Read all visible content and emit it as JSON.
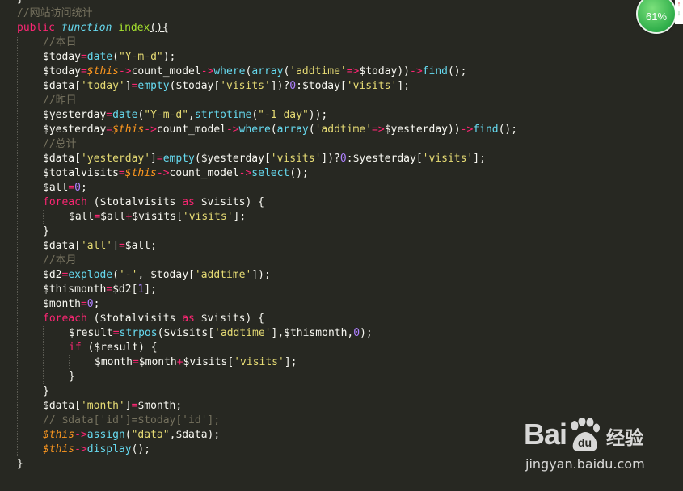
{
  "editor": {
    "lines": [
      {
        "indent": 0,
        "tokens": [
          {
            "t": "}",
            "c": "bracket"
          }
        ]
      },
      {
        "indent": 0,
        "tokens": [
          {
            "t": "//网站访问统计",
            "c": "cm"
          }
        ]
      },
      {
        "indent": 0,
        "tokens": [
          {
            "t": "public",
            "c": "kw"
          },
          {
            "t": " ",
            "c": "var"
          },
          {
            "t": "function",
            "c": "storage"
          },
          {
            "t": " ",
            "c": "var"
          },
          {
            "t": "index",
            "c": "def"
          },
          {
            "t": "(){",
            "c": "brace-hl"
          }
        ]
      },
      {
        "indent": 1,
        "tokens": [
          {
            "t": "//本日",
            "c": "cm"
          }
        ]
      },
      {
        "indent": 1,
        "tokens": [
          {
            "t": "$today",
            "c": "var"
          },
          {
            "t": "=",
            "c": "op"
          },
          {
            "t": "date",
            "c": "fn"
          },
          {
            "t": "(",
            "c": "bracket"
          },
          {
            "t": "\"Y-m-d\"",
            "c": "str"
          },
          {
            "t": ");",
            "c": "bracket"
          }
        ]
      },
      {
        "indent": 1,
        "tokens": [
          {
            "t": "$today",
            "c": "var"
          },
          {
            "t": "=",
            "c": "op"
          },
          {
            "t": "$this",
            "c": "this"
          },
          {
            "t": "->",
            "c": "op"
          },
          {
            "t": "count_model",
            "c": "var"
          },
          {
            "t": "->",
            "c": "op"
          },
          {
            "t": "where",
            "c": "fn"
          },
          {
            "t": "(",
            "c": "bracket"
          },
          {
            "t": "array",
            "c": "fn"
          },
          {
            "t": "(",
            "c": "bracket"
          },
          {
            "t": "'addtime'",
            "c": "str"
          },
          {
            "t": "=>",
            "c": "op"
          },
          {
            "t": "$today",
            "c": "var"
          },
          {
            "t": "))",
            "c": "bracket"
          },
          {
            "t": "->",
            "c": "op"
          },
          {
            "t": "find",
            "c": "fn"
          },
          {
            "t": "();",
            "c": "bracket"
          }
        ]
      },
      {
        "indent": 1,
        "tokens": [
          {
            "t": "$data[",
            "c": "var"
          },
          {
            "t": "'today'",
            "c": "str"
          },
          {
            "t": "]",
            "c": "var"
          },
          {
            "t": "=",
            "c": "op"
          },
          {
            "t": "empty",
            "c": "fn"
          },
          {
            "t": "(",
            "c": "bracket"
          },
          {
            "t": "$today[",
            "c": "var"
          },
          {
            "t": "'visits'",
            "c": "str"
          },
          {
            "t": "])?",
            "c": "var"
          },
          {
            "t": "0",
            "c": "num"
          },
          {
            "t": ":",
            "c": "var"
          },
          {
            "t": "$today[",
            "c": "var"
          },
          {
            "t": "'visits'",
            "c": "str"
          },
          {
            "t": "];",
            "c": "var"
          }
        ]
      },
      {
        "indent": 1,
        "tokens": [
          {
            "t": "//昨日",
            "c": "cm"
          }
        ]
      },
      {
        "indent": 1,
        "tokens": [
          {
            "t": "$yesterday",
            "c": "var"
          },
          {
            "t": "=",
            "c": "op"
          },
          {
            "t": "date",
            "c": "fn"
          },
          {
            "t": "(",
            "c": "bracket"
          },
          {
            "t": "\"Y-m-d\"",
            "c": "str"
          },
          {
            "t": ",",
            "c": "var"
          },
          {
            "t": "strtotime",
            "c": "fn"
          },
          {
            "t": "(",
            "c": "bracket"
          },
          {
            "t": "\"-1 day\"",
            "c": "str"
          },
          {
            "t": "));",
            "c": "bracket"
          }
        ]
      },
      {
        "indent": 1,
        "tokens": [
          {
            "t": "$yesterday",
            "c": "var"
          },
          {
            "t": "=",
            "c": "op"
          },
          {
            "t": "$this",
            "c": "this"
          },
          {
            "t": "->",
            "c": "op"
          },
          {
            "t": "count_model",
            "c": "var"
          },
          {
            "t": "->",
            "c": "op"
          },
          {
            "t": "where",
            "c": "fn"
          },
          {
            "t": "(",
            "c": "bracket"
          },
          {
            "t": "array",
            "c": "fn"
          },
          {
            "t": "(",
            "c": "bracket"
          },
          {
            "t": "'addtime'",
            "c": "str"
          },
          {
            "t": "=>",
            "c": "op"
          },
          {
            "t": "$yesterday",
            "c": "var"
          },
          {
            "t": "))",
            "c": "bracket"
          },
          {
            "t": "->",
            "c": "op"
          },
          {
            "t": "find",
            "c": "fn"
          },
          {
            "t": "();",
            "c": "bracket"
          }
        ]
      },
      {
        "indent": 1,
        "tokens": [
          {
            "t": "//总计",
            "c": "cm"
          }
        ]
      },
      {
        "indent": 1,
        "tokens": [
          {
            "t": "$data[",
            "c": "var"
          },
          {
            "t": "'yesterday'",
            "c": "str"
          },
          {
            "t": "]",
            "c": "var"
          },
          {
            "t": "=",
            "c": "op"
          },
          {
            "t": "empty",
            "c": "fn"
          },
          {
            "t": "(",
            "c": "bracket"
          },
          {
            "t": "$yesterday[",
            "c": "var"
          },
          {
            "t": "'visits'",
            "c": "str"
          },
          {
            "t": "])?",
            "c": "var"
          },
          {
            "t": "0",
            "c": "num"
          },
          {
            "t": ":",
            "c": "var"
          },
          {
            "t": "$yesterday[",
            "c": "var"
          },
          {
            "t": "'visits'",
            "c": "str"
          },
          {
            "t": "];",
            "c": "var"
          }
        ]
      },
      {
        "indent": 1,
        "tokens": [
          {
            "t": "$totalvisits",
            "c": "var"
          },
          {
            "t": "=",
            "c": "op"
          },
          {
            "t": "$this",
            "c": "this"
          },
          {
            "t": "->",
            "c": "op"
          },
          {
            "t": "count_model",
            "c": "var"
          },
          {
            "t": "->",
            "c": "op"
          },
          {
            "t": "select",
            "c": "fn"
          },
          {
            "t": "();",
            "c": "bracket"
          }
        ]
      },
      {
        "indent": 1,
        "tokens": [
          {
            "t": "$all",
            "c": "var"
          },
          {
            "t": "=",
            "c": "op"
          },
          {
            "t": "0",
            "c": "num"
          },
          {
            "t": ";",
            "c": "var"
          }
        ]
      },
      {
        "indent": 1,
        "tokens": [
          {
            "t": "foreach",
            "c": "kw"
          },
          {
            "t": " ($totalvisits ",
            "c": "var"
          },
          {
            "t": "as",
            "c": "kw"
          },
          {
            "t": " $visits) {",
            "c": "var"
          }
        ]
      },
      {
        "indent": 2,
        "tokens": [
          {
            "t": "$all",
            "c": "var"
          },
          {
            "t": "=",
            "c": "op"
          },
          {
            "t": "$all",
            "c": "var"
          },
          {
            "t": "+",
            "c": "op"
          },
          {
            "t": "$visits[",
            "c": "var"
          },
          {
            "t": "'visits'",
            "c": "str"
          },
          {
            "t": "];",
            "c": "var"
          }
        ]
      },
      {
        "indent": 1,
        "tokens": [
          {
            "t": "}",
            "c": "bracket"
          }
        ]
      },
      {
        "indent": 1,
        "tokens": [
          {
            "t": "$data[",
            "c": "var"
          },
          {
            "t": "'all'",
            "c": "str"
          },
          {
            "t": "]",
            "c": "var"
          },
          {
            "t": "=",
            "c": "op"
          },
          {
            "t": "$all;",
            "c": "var"
          }
        ]
      },
      {
        "indent": 1,
        "tokens": [
          {
            "t": "//本月",
            "c": "cm"
          }
        ]
      },
      {
        "indent": 1,
        "tokens": [
          {
            "t": "$d2",
            "c": "var"
          },
          {
            "t": "=",
            "c": "op"
          },
          {
            "t": "explode",
            "c": "fn"
          },
          {
            "t": "(",
            "c": "bracket"
          },
          {
            "t": "'-'",
            "c": "str"
          },
          {
            "t": ", $today[",
            "c": "var"
          },
          {
            "t": "'addtime'",
            "c": "str"
          },
          {
            "t": "]);",
            "c": "var"
          }
        ]
      },
      {
        "indent": 1,
        "tokens": [
          {
            "t": "$thismonth",
            "c": "var"
          },
          {
            "t": "=",
            "c": "op"
          },
          {
            "t": "$d2[",
            "c": "var"
          },
          {
            "t": "1",
            "c": "num"
          },
          {
            "t": "];",
            "c": "var"
          }
        ]
      },
      {
        "indent": 1,
        "tokens": [
          {
            "t": "$month",
            "c": "var"
          },
          {
            "t": "=",
            "c": "op"
          },
          {
            "t": "0",
            "c": "num"
          },
          {
            "t": ";",
            "c": "var"
          }
        ]
      },
      {
        "indent": 1,
        "tokens": [
          {
            "t": "foreach",
            "c": "kw"
          },
          {
            "t": " ($totalvisits ",
            "c": "var"
          },
          {
            "t": "as",
            "c": "kw"
          },
          {
            "t": " $visits) {",
            "c": "var"
          }
        ]
      },
      {
        "indent": 2,
        "tokens": [
          {
            "t": "$result",
            "c": "var"
          },
          {
            "t": "=",
            "c": "op"
          },
          {
            "t": "strpos",
            "c": "fn"
          },
          {
            "t": "(",
            "c": "bracket"
          },
          {
            "t": "$visits[",
            "c": "var"
          },
          {
            "t": "'addtime'",
            "c": "str"
          },
          {
            "t": "],$thismonth,",
            "c": "var"
          },
          {
            "t": "0",
            "c": "num"
          },
          {
            "t": ");",
            "c": "bracket"
          }
        ]
      },
      {
        "indent": 2,
        "tokens": [
          {
            "t": "if",
            "c": "kw"
          },
          {
            "t": " ($result) {",
            "c": "var"
          }
        ]
      },
      {
        "indent": 3,
        "tokens": [
          {
            "t": "$month",
            "c": "var"
          },
          {
            "t": "=",
            "c": "op"
          },
          {
            "t": "$month",
            "c": "var"
          },
          {
            "t": "+",
            "c": "op"
          },
          {
            "t": "$visits[",
            "c": "var"
          },
          {
            "t": "'visits'",
            "c": "str"
          },
          {
            "t": "];",
            "c": "var"
          }
        ]
      },
      {
        "indent": 2,
        "tokens": [
          {
            "t": "}",
            "c": "bracket"
          }
        ]
      },
      {
        "indent": 1,
        "tokens": [
          {
            "t": "}",
            "c": "bracket"
          }
        ]
      },
      {
        "indent": 1,
        "tokens": [
          {
            "t": "$data[",
            "c": "var"
          },
          {
            "t": "'month'",
            "c": "str"
          },
          {
            "t": "]",
            "c": "var"
          },
          {
            "t": "=",
            "c": "op"
          },
          {
            "t": "$month;",
            "c": "var"
          }
        ]
      },
      {
        "indent": 1,
        "tokens": [
          {
            "t": "// $data['id']=$today['id'];",
            "c": "cm"
          }
        ]
      },
      {
        "indent": 1,
        "tokens": [
          {
            "t": "$this",
            "c": "this"
          },
          {
            "t": "->",
            "c": "op"
          },
          {
            "t": "assign",
            "c": "fn"
          },
          {
            "t": "(",
            "c": "bracket"
          },
          {
            "t": "\"data\"",
            "c": "str"
          },
          {
            "t": ",$data);",
            "c": "var"
          }
        ]
      },
      {
        "indent": 1,
        "tokens": [
          {
            "t": "$this",
            "c": "this"
          },
          {
            "t": "->",
            "c": "op"
          },
          {
            "t": "display",
            "c": "fn"
          },
          {
            "t": "();",
            "c": "bracket"
          }
        ]
      },
      {
        "indent": 0,
        "tokens": [
          {
            "t": "}",
            "c": "brace-hl"
          }
        ]
      }
    ]
  },
  "mem_widget": {
    "percent": "61%",
    "up_arrow": "↑",
    "down_arrow": "↓"
  },
  "watermark": {
    "logo_text": "Bai",
    "logo_paw_text": "du",
    "name": "经验",
    "domain": "jingyan.baidu.com"
  }
}
